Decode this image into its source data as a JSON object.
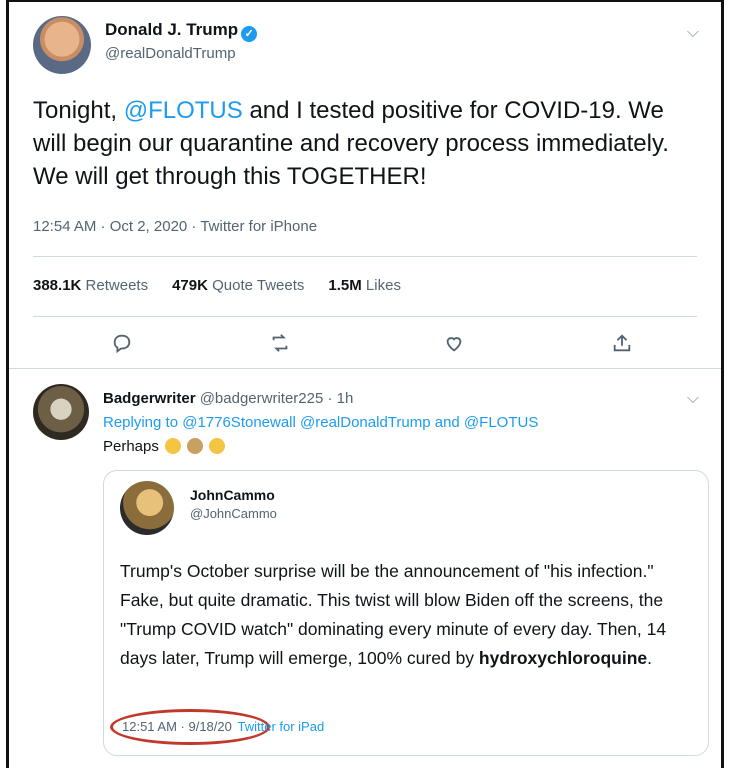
{
  "tweet": {
    "display_name": "Donald J. Trump",
    "handle": "@realDonaldTrump",
    "text_before": "Tonight, ",
    "mention": "@FLOTUS",
    "text_after": " and I tested positive for COVID-19. We will begin our quarantine and recovery process immediately. We will get through this TOGETHER!",
    "time": "12:54 AM · Oct 2, 2020 · Twitter for iPhone",
    "stats": {
      "retweets_count": "388.1K",
      "retweets_label": "Retweets",
      "quotes_count": "479K",
      "quotes_label": "Quote Tweets",
      "likes_count": "1.5M",
      "likes_label": "Likes"
    }
  },
  "reply": {
    "display_name": "Badgerwriter",
    "handle_time": "@badgerwriter225 · 1h",
    "replying": "Replying to @1776Stonewall @realDonaldTrump and @FLOTUS",
    "text": "Perhaps"
  },
  "quote": {
    "display_name": "JohnCammo",
    "handle": "@JohnCammo",
    "text_main": "Trump's October surprise will be the announcement of \"his infection.\"  Fake, but quite dramatic. This twist will blow Biden off the screens, the \"Trump COVID watch\" dominating every minute of every day.  Then, 14 days later, Trump will emerge, 100% cured by ",
    "text_bold": "hydroxychloroquine",
    "text_end": ".",
    "time": "12:51 AM · 9/18/20",
    "source": "Twitter for iPad"
  },
  "colors": {
    "accent": "#1d9bf0",
    "circle": "#c0392b"
  }
}
